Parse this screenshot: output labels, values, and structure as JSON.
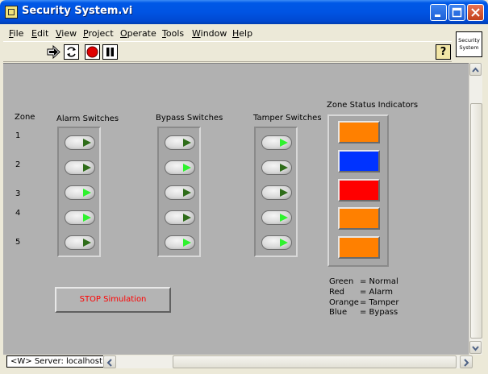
{
  "window": {
    "title": "Security System.vi"
  },
  "menu": [
    "File",
    "Edit",
    "View",
    "Project",
    "Operate",
    "Tools",
    "Window",
    "Help"
  ],
  "menu_mnemonic": [
    "F",
    "E",
    "V",
    "P",
    "O",
    "T",
    "W",
    "H"
  ],
  "toolbar": {
    "icons": [
      "run-arrow-icon",
      "run-continuously-icon",
      "abort-execution-icon",
      "pause-icon",
      "context-help-icon"
    ],
    "help_glyph": "?"
  },
  "vi_icon_text": "Security System",
  "panel": {
    "zone_label": "Zone",
    "zones": [
      "1",
      "2",
      "3",
      "4",
      "5"
    ],
    "alarm_label": "Alarm Switches",
    "bypass_label": "Bypass Switches",
    "tamper_label": "Tamper Switches",
    "status_label": "Zone Status Indicators",
    "alarm_states": [
      false,
      false,
      true,
      true,
      false
    ],
    "bypass_states": [
      false,
      true,
      false,
      false,
      true
    ],
    "tamper_states": [
      true,
      false,
      false,
      true,
      true
    ],
    "indicator_colors": [
      "#ff8000",
      "#0033ff",
      "#ff0000",
      "#ff8000",
      "#ff8000"
    ],
    "stop_label": "STOP Simulation",
    "legend": [
      {
        "color": "Green",
        "meaning": "= Normal"
      },
      {
        "color": "Red",
        "meaning": "= Alarm"
      },
      {
        "color": "Orange",
        "meaning": "= Tamper"
      },
      {
        "color": "Blue",
        "meaning": "= Bypass"
      }
    ]
  },
  "status": {
    "server": "<W> Server: localhost"
  }
}
